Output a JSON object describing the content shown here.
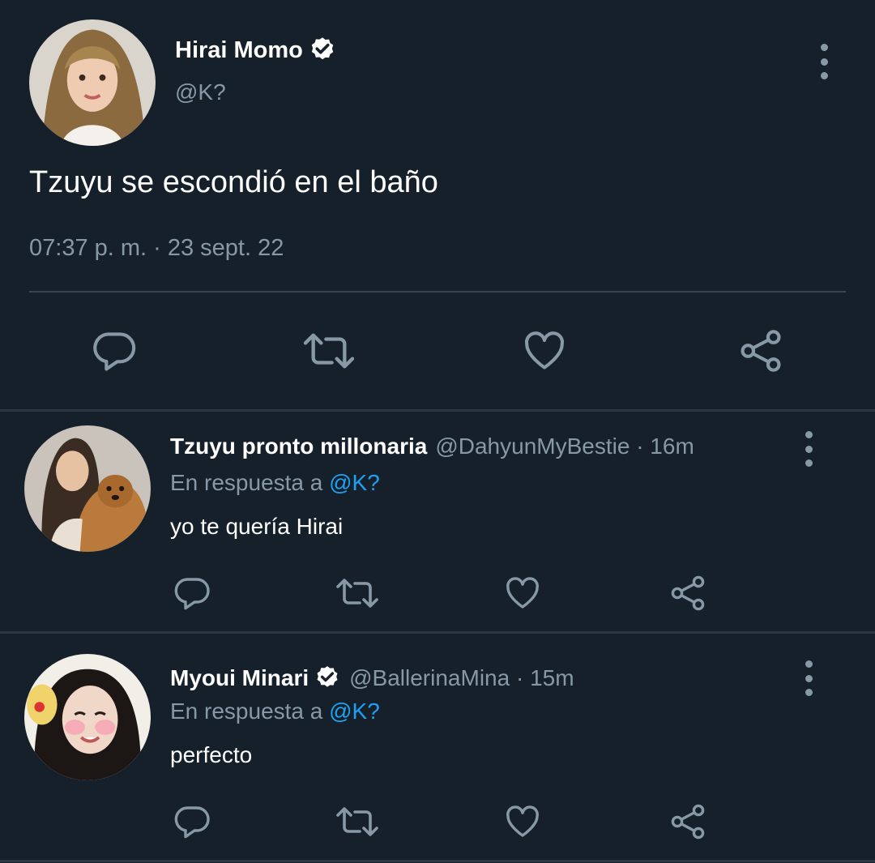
{
  "theme": {
    "background": "#15202b",
    "text_primary": "#ffffff",
    "text_secondary": "#8899a6",
    "link": "#1da1f2",
    "divider": "#38444d"
  },
  "main_tweet": {
    "author_name": "Hirai Momo",
    "verified": true,
    "handle": "@K?",
    "text": "Tzuyu se escondió en el baño",
    "timestamp": "07:37 p. m. · 23 sept. 22",
    "actions": [
      "reply-icon",
      "retweet-icon",
      "like-icon",
      "share-icon"
    ]
  },
  "replies": [
    {
      "author_name": "Tzuyu pronto millonaria",
      "verified": false,
      "meta": "@DahyunMyBestie · 16m",
      "reply_prefix": "En respuesta a",
      "reply_to": "@K?",
      "text": "yo te quería Hirai"
    },
    {
      "author_name": "Myoui Minari",
      "verified": true,
      "meta": "@BallerinaMina · 15m",
      "reply_prefix": "En respuesta a",
      "reply_to": "@K?",
      "text": "perfecto"
    }
  ]
}
